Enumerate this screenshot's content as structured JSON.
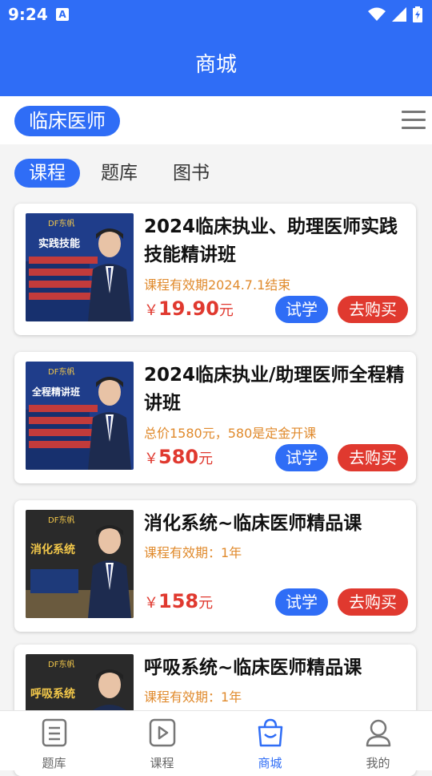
{
  "status": {
    "time": "9:24"
  },
  "header": {
    "title": "商城"
  },
  "category": {
    "selected": "临床医师"
  },
  "tabs": [
    {
      "label": "课程"
    },
    {
      "label": "题库"
    },
    {
      "label": "图书"
    }
  ],
  "courses": [
    {
      "title": "2024临床执业、助理医师实践技能精讲班",
      "sub": "课程有效期2024.7.1结束",
      "yen": "￥",
      "price": "19.90",
      "unit": "元",
      "thumb": {
        "brand": "DF东帆",
        "headline": "实践技能"
      }
    },
    {
      "title": "2024临床执业/助理医师全程精讲班",
      "sub": "总价1580元，580是定金开课",
      "yen": "￥",
      "price": "580",
      "unit": "元",
      "thumb": {
        "brand": "DF东帆",
        "headline": "全程精讲班"
      }
    },
    {
      "title": "消化系统~临床医师精品课",
      "sub": "课程有效期：1年",
      "yen": "￥",
      "price": "158",
      "unit": "元",
      "thumb": {
        "brand": "DF东帆",
        "headline": "消化系统"
      }
    },
    {
      "title": "呼吸系统~临床医师精品课",
      "sub": "课程有效期：1年",
      "thumb": {
        "brand": "DF东帆",
        "headline": "呼吸系统"
      }
    }
  ],
  "actions": {
    "try": "试学",
    "buy": "去购买"
  },
  "nav": [
    {
      "label": "题库"
    },
    {
      "label": "课程"
    },
    {
      "label": "商城"
    },
    {
      "label": "我的"
    }
  ],
  "colors": {
    "primary": "#2f6df6",
    "buy": "#e0392f",
    "note": "#e08a2c"
  }
}
